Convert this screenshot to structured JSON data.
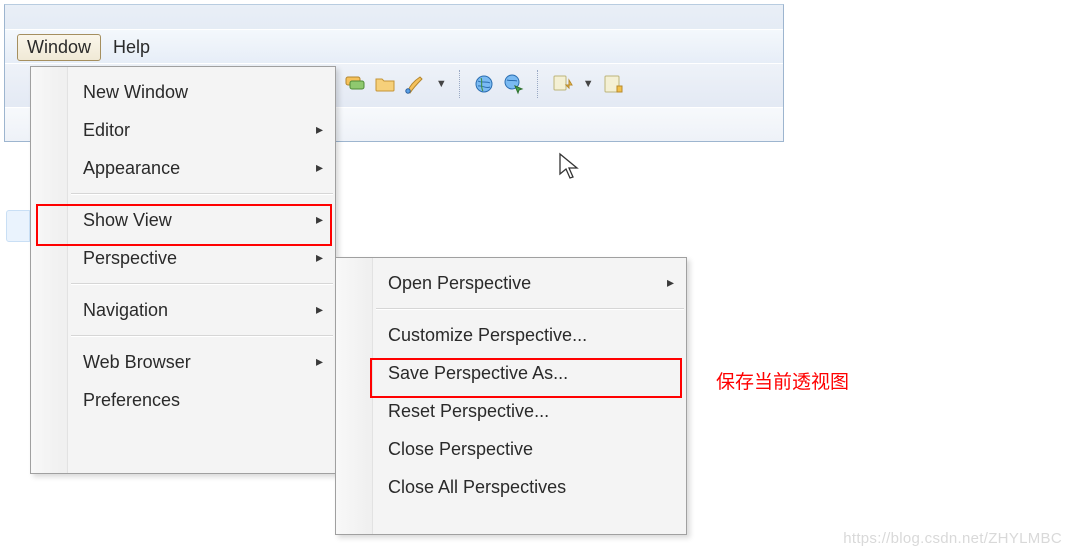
{
  "menubar": {
    "window": "Window",
    "help": "Help"
  },
  "toolbar_icons": {
    "servers": "servers-icon",
    "open": "open-folder-icon",
    "brush": "brush-icon",
    "globe": "globe-icon",
    "run_globe": "globe-run-icon",
    "import": "import-icon",
    "properties": "properties-icon"
  },
  "window_menu": {
    "new_window": "New Window",
    "editor": "Editor",
    "appearance": "Appearance",
    "show_view": "Show View",
    "perspective": "Perspective",
    "navigation": "Navigation",
    "web_browser": "Web Browser",
    "preferences": "Preferences"
  },
  "perspective_submenu": {
    "open": "Open Perspective",
    "customize": "Customize Perspective...",
    "save_as": "Save Perspective As...",
    "reset": "Reset Perspective...",
    "close": "Close Perspective",
    "close_all": "Close All Perspectives"
  },
  "annotation": "保存当前透视图",
  "watermark": "https://blog.csdn.net/ZHYLMBC"
}
